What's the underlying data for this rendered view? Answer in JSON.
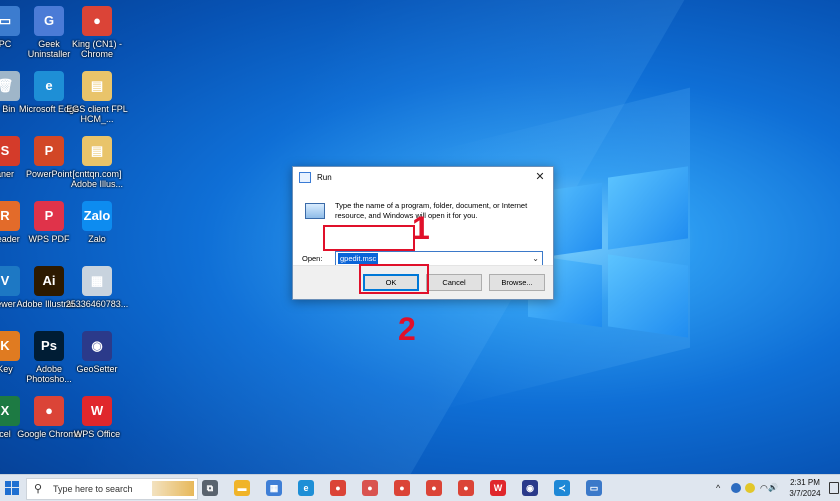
{
  "desktop_icons": [
    {
      "label": "PC",
      "color": "#3c7ccf",
      "glyph": "▭"
    },
    {
      "label": "Geek Uninstaller",
      "color": "#4b7bd6",
      "glyph": "G"
    },
    {
      "label": "King (CN1) - Chrome",
      "color": "#db4437",
      "glyph": "●"
    },
    {
      "label": "e Bin",
      "color": "#9fb6c9",
      "glyph": "🗑"
    },
    {
      "label": "Microsoft Edge",
      "color": "#1e8fd6",
      "glyph": "e"
    },
    {
      "label": "EGS client FPL HCM_...",
      "color": "#e9c46a",
      "glyph": "▤"
    },
    {
      "label": "aner",
      "color": "#d43b2a",
      "glyph": "S"
    },
    {
      "label": "PowerPoint",
      "color": "#d24726",
      "glyph": "P"
    },
    {
      "label": "[cnttqn.com] Adobe Illus...",
      "color": "#e9c46a",
      "glyph": "▤"
    },
    {
      "label": "Reader",
      "color": "#e36b2a",
      "glyph": "R"
    },
    {
      "label": "WPS PDF",
      "color": "#e0334a",
      "glyph": "P"
    },
    {
      "label": "Zalo",
      "color": "#0d8cf0",
      "glyph": "Zalo"
    },
    {
      "label": "iewer",
      "color": "#1d78c4",
      "glyph": "V"
    },
    {
      "label": "Adobe Illustrat...",
      "color": "#2d1a00",
      "glyph": "Ai"
    },
    {
      "label": "25336460783...",
      "color": "#c8d3de",
      "glyph": "▦"
    },
    {
      "label": "Key",
      "color": "#e07b21",
      "glyph": "K"
    },
    {
      "label": "Adobe Photosho...",
      "color": "#001d35",
      "glyph": "Ps"
    },
    {
      "label": "GeoSetter",
      "color": "#2b3a8a",
      "glyph": "◉"
    },
    {
      "label": "cel",
      "color": "#1d7a43",
      "glyph": "X"
    },
    {
      "label": "Google Chrome",
      "color": "#db4437",
      "glyph": "●"
    },
    {
      "label": "WPS Office",
      "color": "#e0272c",
      "glyph": "W"
    }
  ],
  "run_dialog": {
    "title": "Run",
    "close_glyph": "✕",
    "description": "Type the name of a program, folder, document, or Internet resource, and Windows will open it for you.",
    "open_label": "Open:",
    "open_value": "gpedit.msc",
    "ok_label": "OK",
    "cancel_label": "Cancel",
    "browse_label": "Browse..."
  },
  "annotations": {
    "step1": "1",
    "step2": "2"
  },
  "taskbar": {
    "search_placeholder": "Type here to search",
    "search_glyph": "⚲",
    "time": "2:31 PM",
    "date": "3/7/2024",
    "apps": [
      {
        "name": "task-view",
        "glyph": "⧉",
        "color": "#59636e"
      },
      {
        "name": "file-explorer",
        "glyph": "▬",
        "color": "#f0b429"
      },
      {
        "name": "store",
        "glyph": "▦",
        "color": "#3f7fd6"
      },
      {
        "name": "edge",
        "glyph": "e",
        "color": "#1e8fd6"
      },
      {
        "name": "chrome",
        "glyph": "●",
        "color": "#db4437"
      },
      {
        "name": "chrome-profile",
        "glyph": "●",
        "color": "#d9534f"
      },
      {
        "name": "chrome-2",
        "glyph": "●",
        "color": "#db4437"
      },
      {
        "name": "chrome-3",
        "glyph": "●",
        "color": "#db4437"
      },
      {
        "name": "chrome-4",
        "glyph": "●",
        "color": "#db4437"
      },
      {
        "name": "wps",
        "glyph": "W",
        "color": "#e0272c"
      },
      {
        "name": "app-geosetter",
        "glyph": "◉",
        "color": "#2b3a8a"
      },
      {
        "name": "vscode",
        "glyph": "≺",
        "color": "#1e88d6"
      },
      {
        "name": "run",
        "glyph": "▭",
        "color": "#3b79c9"
      }
    ],
    "tray": {
      "chevron": "^",
      "wifi": "◠",
      "volume": "🔊"
    }
  }
}
